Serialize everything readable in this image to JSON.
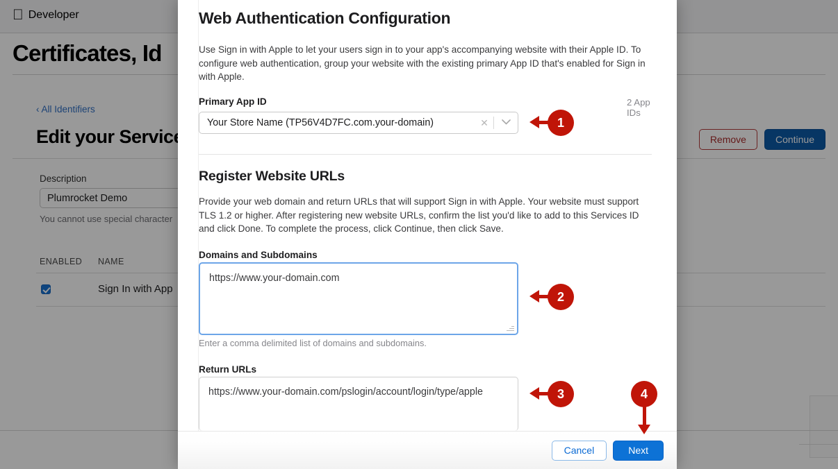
{
  "background": {
    "nav": {
      "apple_logo_icon": "apple-icon",
      "brand": "Developer"
    },
    "page_title": "Certificates, Id",
    "breadcrumb": "‹ All Identifiers",
    "section_title": "Edit your Services",
    "actions": {
      "remove_label": "Remove",
      "continue_label": "Continue"
    },
    "form": {
      "description_label": "Description",
      "description_value": "Plumrocket Demo",
      "description_helper": "You cannot use special character"
    },
    "table": {
      "columns": [
        "ENABLED",
        "NAME"
      ],
      "rows": [
        {
          "enabled": true,
          "name": "Sign In with App"
        }
      ]
    }
  },
  "modal": {
    "title": "Web Authentication Configuration",
    "description": "Use Sign in with Apple to let your users sign in to your app's accompanying website with their Apple ID. To configure web authentication, group your website with the existing primary App ID that's enabled for Sign in with Apple.",
    "primary_app_id": {
      "label": "Primary App ID",
      "count": "2 App IDs",
      "value": "Your Store Name (TP56V4D7FC.com.your-domain)",
      "clear_icon": "✕",
      "chevron_icon": "⌄"
    },
    "register_urls": {
      "heading": "Register Website URLs",
      "description": "Provide your web domain and return URLs that will support Sign in with Apple. Your website must support TLS 1.2 or higher. After registering new website URLs, confirm the list you'd like to add to this Services ID and click Done. To complete the process, click Continue, then click Save.",
      "domains_label": "Domains and Subdomains",
      "domains_value": "https://www.your-domain.com",
      "domains_hint": "Enter a comma delimited list of domains and subdomains.",
      "return_label": "Return URLs",
      "return_value": "https://www.your-domain.com/pslogin/account/login/type/apple"
    },
    "footer": {
      "cancel_label": "Cancel",
      "next_label": "Next"
    }
  },
  "annotations": {
    "accent_color": "#c01508",
    "markers": [
      {
        "number": "1"
      },
      {
        "number": "2"
      },
      {
        "number": "3"
      },
      {
        "number": "4"
      }
    ]
  }
}
